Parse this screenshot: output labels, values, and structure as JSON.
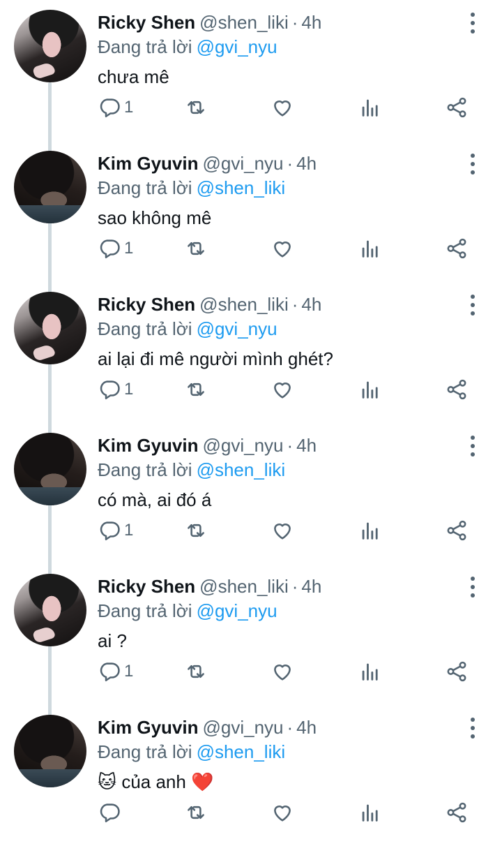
{
  "reply_prefix": "Đang trả lời",
  "more_icon": "more-vertical-icon",
  "tweets": [
    {
      "name": "Ricky Shen",
      "handle": "@shen_liki",
      "time": "4h",
      "replying_to": "@gvi_nyu",
      "text": "chưa mê",
      "reply_count": "1",
      "avatar": "ricky"
    },
    {
      "name": "Kim Gyuvin",
      "handle": "@gvi_nyu",
      "time": "4h",
      "replying_to": "@shen_liki",
      "text": "sao không mê",
      "reply_count": "1",
      "avatar": "kim"
    },
    {
      "name": "Ricky Shen",
      "handle": "@shen_liki",
      "time": "4h",
      "replying_to": "@gvi_nyu",
      "text": "ai lại đi mê người mình ghét?",
      "reply_count": "1",
      "avatar": "ricky"
    },
    {
      "name": "Kim Gyuvin",
      "handle": "@gvi_nyu",
      "time": "4h",
      "replying_to": "@shen_liki",
      "text": "có mà, ai đó á",
      "reply_count": "1",
      "avatar": "kim"
    },
    {
      "name": "Ricky Shen",
      "handle": "@shen_liki",
      "time": "4h",
      "replying_to": "@gvi_nyu",
      "text": "ai ?",
      "reply_count": "1",
      "avatar": "ricky"
    },
    {
      "name": "Kim Gyuvin",
      "handle": "@gvi_nyu",
      "time": "4h",
      "replying_to": "@shen_liki",
      "text": "🐱 của anh ❤️",
      "reply_count": "",
      "avatar": "kim"
    }
  ],
  "action_icons": [
    "reply-icon",
    "retweet-icon",
    "like-icon",
    "views-icon",
    "share-icon"
  ],
  "colors": {
    "text": "#0f1419",
    "secondary": "#536471",
    "mention": "#1d9bf0",
    "thread_line": "#cfd9de"
  }
}
